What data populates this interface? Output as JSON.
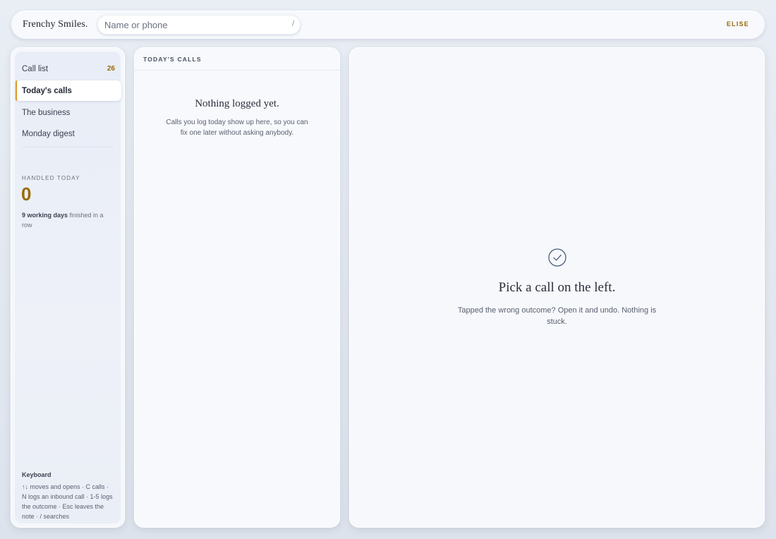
{
  "header": {
    "brand": "Frenchy Smiles",
    "brand_dot": ".",
    "search_placeholder": "Name or phone",
    "search_shortcut": "/",
    "user": "ELISE"
  },
  "sidebar": {
    "items": [
      {
        "label": "Call list",
        "count": "26"
      },
      {
        "label": "Today's calls"
      },
      {
        "label": "The business"
      },
      {
        "label": "Monday digest"
      }
    ],
    "stat_label": "HANDLED TODAY",
    "stat_value": "0",
    "streak_bold": "9 working days",
    "streak_rest": " finished in a row",
    "keyboard_title": "Keyboard",
    "keyboard_text": "↑↓ moves and opens · C calls · N logs an inbound call · 1-5 logs the outcome · Esc leaves the note · / searches"
  },
  "calls": {
    "header": "TODAY'S CALLS",
    "empty_title": "Nothing logged yet.",
    "empty_text": "Calls you log today show up here, so you can fix one later without asking anybody."
  },
  "detail": {
    "icon": "check-circle-icon",
    "title": "Pick a call on the left.",
    "text": "Tapped the wrong outcome? Open it and undo. Nothing is stuck."
  },
  "colors": {
    "accent": "#9a6a0a",
    "active_bar": "#d89a2c"
  }
}
